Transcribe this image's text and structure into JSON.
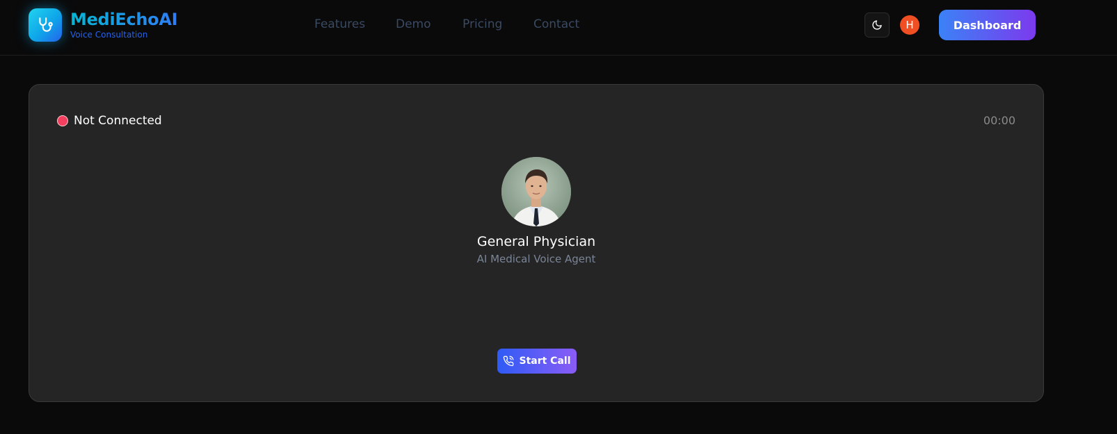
{
  "brand": {
    "name": "MediEchoAI",
    "tagline": "Voice Consultation",
    "logo_icon": "stethoscope-icon"
  },
  "nav": {
    "links": [
      {
        "label": "Features"
      },
      {
        "label": "Demo"
      },
      {
        "label": "Pricing"
      },
      {
        "label": "Contact"
      }
    ]
  },
  "header_actions": {
    "theme_icon": "moon-icon",
    "avatar_initial": "H",
    "dashboard_label": "Dashboard"
  },
  "session": {
    "status_label": "Not Connected",
    "timer": "00:00"
  },
  "agent": {
    "name": "General Physician",
    "role": "AI Medical Voice Agent"
  },
  "call": {
    "start_label": "Start Call",
    "icon": "phone-call-icon"
  },
  "colors": {
    "background": "#0a0a0a",
    "card": "#252525",
    "accent_blue": "#3b82f6",
    "accent_purple": "#7c3aed",
    "status_disconnected": "#f43f5e",
    "avatar": "#ef4f22"
  }
}
